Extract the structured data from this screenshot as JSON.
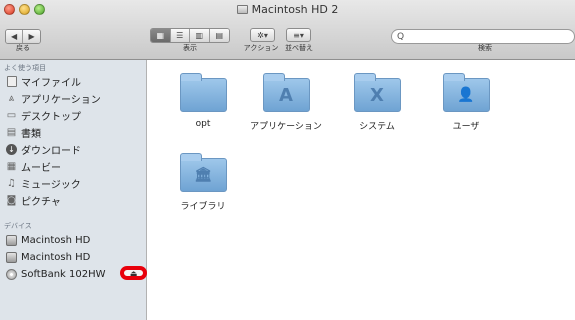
{
  "window": {
    "title": "Macintosh HD 2"
  },
  "toolbar": {
    "back_label": "戻る",
    "view_label": "表示",
    "action_label": "アクション",
    "arrange_label": "並べ替え",
    "search_label": "検索",
    "search_placeholder": "Q",
    "view_modes": [
      "icon",
      "list",
      "column",
      "coverflow"
    ]
  },
  "sidebar": {
    "favorites_header": "よく使う項目",
    "favorites": [
      {
        "label": "マイファイル",
        "icon": "myfiles-icon"
      },
      {
        "label": "アプリケーション",
        "icon": "applications-icon"
      },
      {
        "label": "デスクトップ",
        "icon": "desktop-icon"
      },
      {
        "label": "書類",
        "icon": "documents-icon"
      },
      {
        "label": "ダウンロード",
        "icon": "downloads-icon"
      },
      {
        "label": "ムービー",
        "icon": "movies-icon"
      },
      {
        "label": "ミュージック",
        "icon": "music-icon"
      },
      {
        "label": "ピクチャ",
        "icon": "pictures-icon"
      }
    ],
    "devices_header": "デバイス",
    "devices": [
      {
        "label": "Macintosh HD",
        "icon": "hard-disk-icon"
      },
      {
        "label": "Macintosh HD",
        "icon": "hard-disk-icon"
      },
      {
        "label": "SoftBank 102HW",
        "icon": "cd-icon"
      }
    ],
    "eject_symbol": "⏏",
    "highlight_color": "#e8000b"
  },
  "content": {
    "items": [
      {
        "label": "opt",
        "glyph": ""
      },
      {
        "label": "アプリケーション",
        "glyph": "A"
      },
      {
        "label": "システム",
        "glyph": "X"
      },
      {
        "label": "ユーザ",
        "glyph": "👤"
      },
      {
        "label": "ライブラリ",
        "glyph": "🏛"
      }
    ]
  }
}
